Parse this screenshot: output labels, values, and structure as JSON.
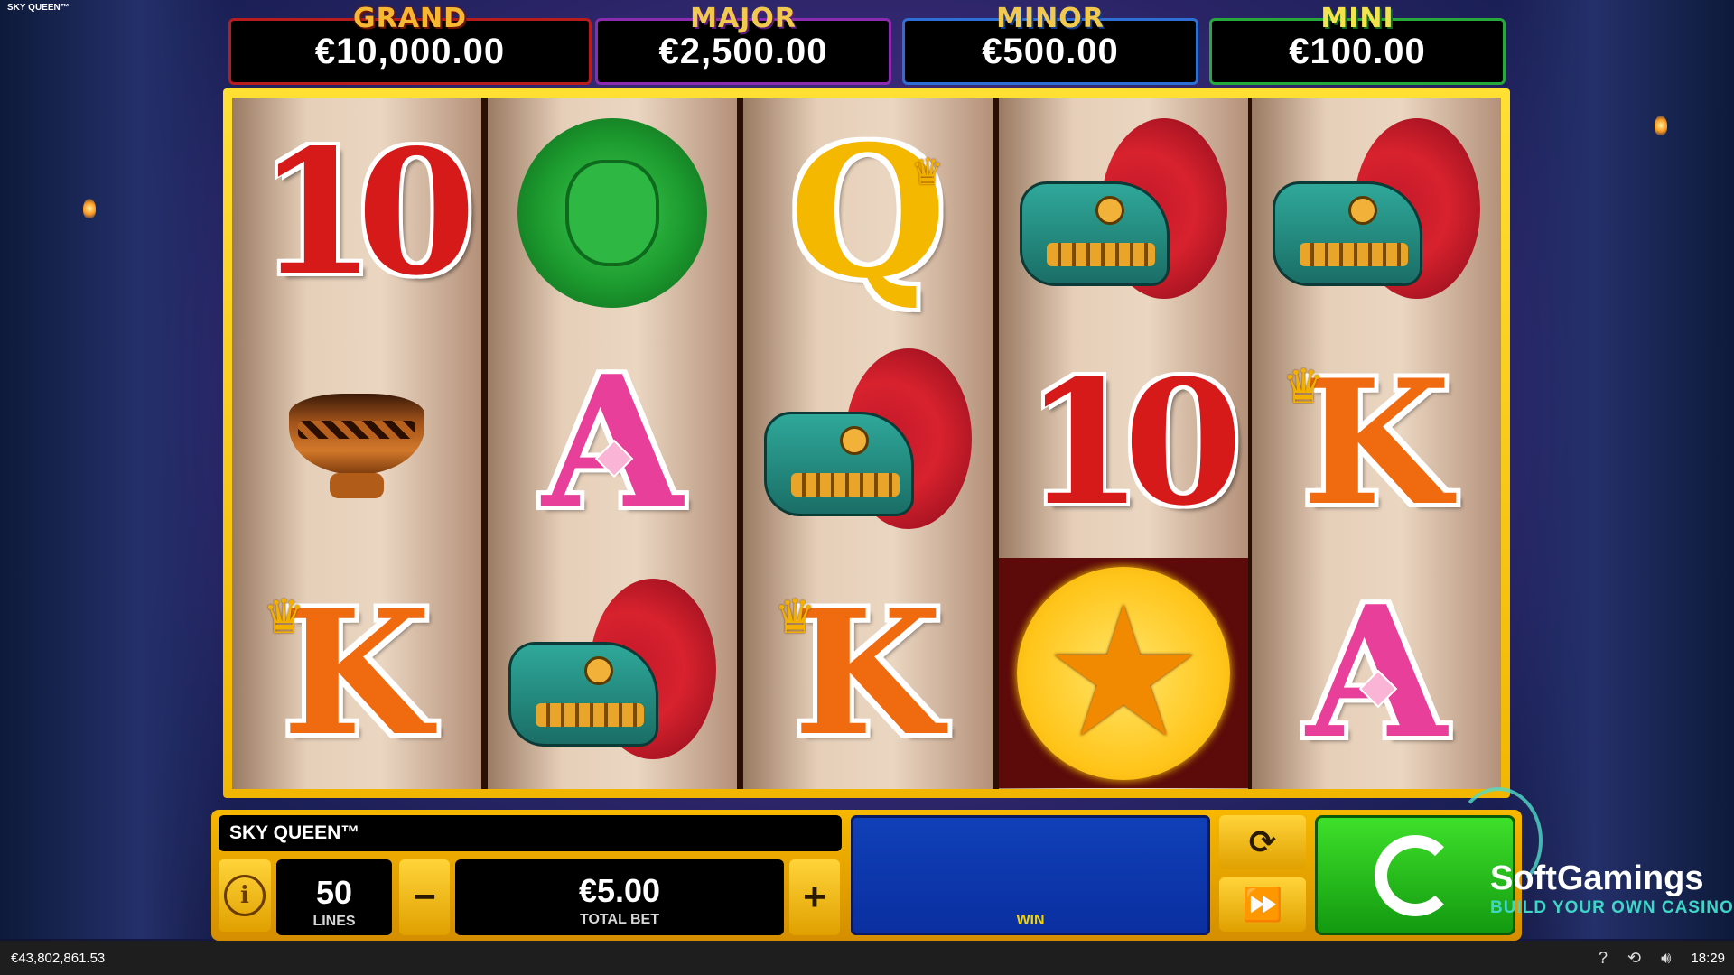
{
  "window": {
    "title": "SKY QUEEN™"
  },
  "jackpots": [
    {
      "label": "GRAND",
      "value": "€10,000.00"
    },
    {
      "label": "MAJOR",
      "value": "€2,500.00"
    },
    {
      "label": "MINOR",
      "value": "€500.00"
    },
    {
      "label": "MINI",
      "value": "€100.00"
    }
  ],
  "reels": [
    [
      "10",
      "bowl",
      "K"
    ],
    [
      "mask",
      "A",
      "dragon"
    ],
    [
      "Q",
      "dragon",
      "K"
    ],
    [
      "dragon",
      "10",
      "star"
    ],
    [
      "dragon",
      "K",
      "A"
    ]
  ],
  "panel": {
    "game_title": "SKY QUEEN™",
    "lines_value": "50",
    "lines_label": "LINES",
    "bet_value": "€5.00",
    "bet_label": "TOTAL BET",
    "win_label": "WIN",
    "minus": "−",
    "plus": "+",
    "info_icon": "info-icon",
    "autoplay_icon": "refresh-icon",
    "turbo_icon": "fast-forward-icon",
    "spin_icon": "spin-icon"
  },
  "watermark": {
    "brand": "SoftGamings",
    "tagline": "BUILD YOUR OWN CASINO"
  },
  "status": {
    "balance": "€43,802,861.53",
    "help": "?",
    "history_icon": "history-icon",
    "sound_icon": "speaker-icon",
    "time": "18:29"
  }
}
